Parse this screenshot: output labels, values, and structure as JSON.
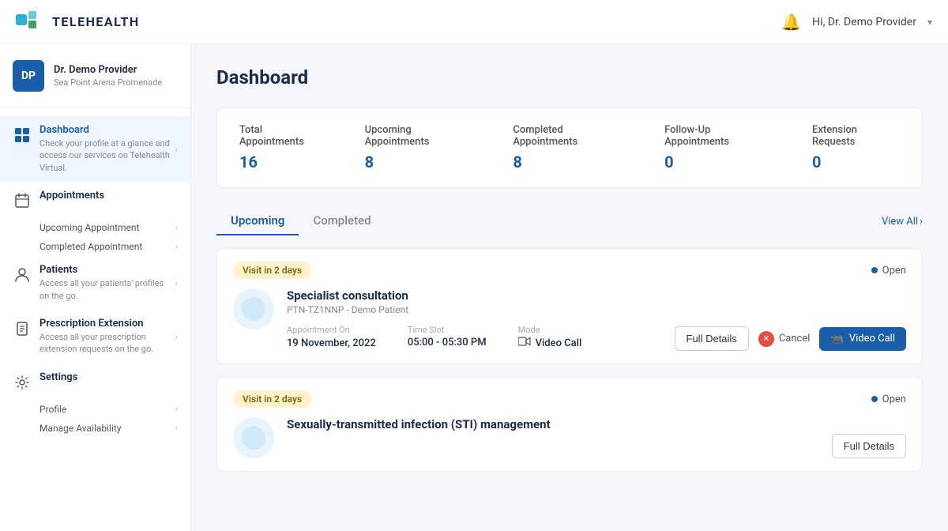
{
  "app": {
    "name": "TELEHEALTH"
  },
  "topnav": {
    "user_greeting": "Hi, Dr. Demo Provider",
    "bell_label": "notifications"
  },
  "sidebar": {
    "profile": {
      "initials": "DP",
      "name": "Dr. Demo Provider",
      "location": "Sea Point Arena Promenade"
    },
    "nav_items": [
      {
        "id": "dashboard",
        "label": "Dashboard",
        "desc": "Check your profile at a glance and access our services on Telehealth Virtual.",
        "active": true,
        "sub_items": []
      },
      {
        "id": "appointments",
        "label": "Appointments",
        "desc": "",
        "active": false,
        "sub_items": [
          {
            "label": "Upcoming Appointment"
          },
          {
            "label": "Completed Appointment"
          }
        ]
      },
      {
        "id": "patients",
        "label": "Patients",
        "desc": "Access all your patients' profiles on the go.",
        "active": false,
        "sub_items": []
      },
      {
        "id": "prescription",
        "label": "Prescription Extension",
        "desc": "Access all your prescription extension requests on the go.",
        "active": false,
        "sub_items": []
      },
      {
        "id": "settings",
        "label": "Settings",
        "desc": "",
        "active": false,
        "sub_items": [
          {
            "label": "Profile"
          },
          {
            "label": "Manage Availability"
          }
        ]
      }
    ]
  },
  "dashboard": {
    "title": "Dashboard",
    "stats": {
      "total_appointments_label": "Total Appointments",
      "total_appointments_value": "16",
      "upcoming_appointments_label": "Upcoming Appointments",
      "upcoming_appointments_value": "8",
      "completed_appointments_label": "Completed Appointments",
      "completed_appointments_value": "8",
      "followup_appointments_label": "Follow-Up Appointments",
      "followup_appointments_value": "0",
      "extension_requests_label": "Extension Requests",
      "extension_requests_value": "0"
    },
    "tabs": {
      "upcoming_label": "Upcoming",
      "completed_label": "Completed",
      "view_all_label": "View All"
    },
    "appointments": [
      {
        "visit_badge": "Visit in 2 days",
        "status": "Open",
        "title": "Specialist consultation",
        "patient": "PTN-TZ1NNP - Demo Patient",
        "appointment_on_label": "Appointment On",
        "date": "19 November, 2022",
        "time_slot_label": "Time Slot",
        "time_slot": "05:00 - 05:30 PM",
        "mode_label": "Mode",
        "mode": "Video Call",
        "full_details_label": "Full Details",
        "cancel_label": "Cancel",
        "video_call_label": "Video Call",
        "icon": "🩺"
      },
      {
        "visit_badge": "Visit in 2 days",
        "status": "Open",
        "title": "Sexually-transmitted infection (STI) management",
        "patient": "",
        "appointment_on_label": "",
        "date": "",
        "time_slot_label": "",
        "time_slot": "",
        "mode_label": "",
        "mode": "",
        "full_details_label": "Full Details",
        "cancel_label": "",
        "video_call_label": "",
        "icon": "🩺"
      }
    ]
  }
}
